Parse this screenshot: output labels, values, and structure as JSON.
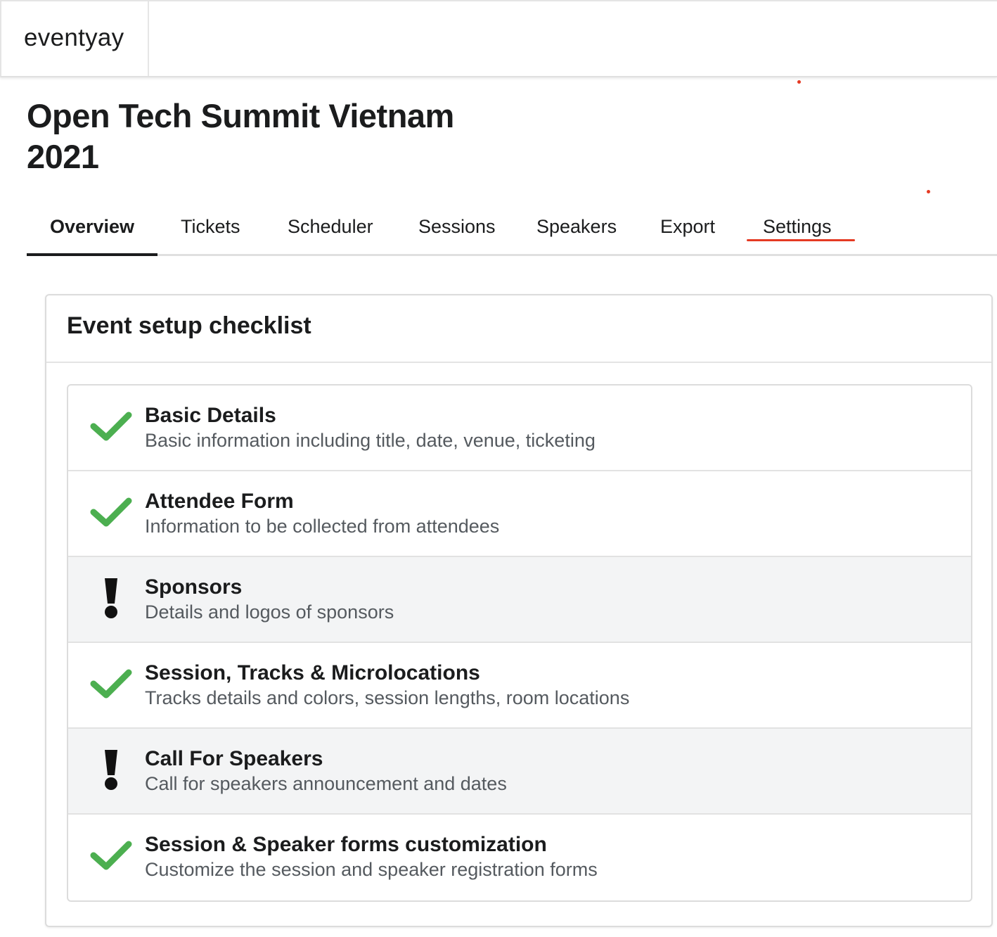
{
  "app": {
    "brand": "eventyay"
  },
  "event": {
    "title": "Open Tech Summit Vietnam 2021"
  },
  "tabs": [
    {
      "label": "Overview",
      "active": true
    },
    {
      "label": "Tickets",
      "active": false
    },
    {
      "label": "Scheduler",
      "active": false
    },
    {
      "label": "Sessions",
      "active": false
    },
    {
      "label": "Speakers",
      "active": false
    },
    {
      "label": "Export",
      "active": false
    },
    {
      "label": "Settings",
      "active": false
    }
  ],
  "checklist": {
    "title": "Event setup checklist",
    "items": [
      {
        "title": "Basic Details",
        "description": "Basic information including title, date, venue, ticketing",
        "status": "complete",
        "icon": "check-icon"
      },
      {
        "title": "Attendee Form",
        "description": "Information to be collected from attendees",
        "status": "complete",
        "icon": "check-icon"
      },
      {
        "title": "Sponsors",
        "description": "Details and logos of sponsors",
        "status": "incomplete",
        "icon": "exclamation-icon"
      },
      {
        "title": "Session, Tracks & Microlocations",
        "description": "Tracks details and colors, session lengths, room locations",
        "status": "complete",
        "icon": "check-icon"
      },
      {
        "title": "Call For Speakers",
        "description": "Call for speakers announcement and dates",
        "status": "incomplete",
        "icon": "exclamation-icon"
      },
      {
        "title": "Session & Speaker forms customization",
        "description": "Customize the session and speaker registration forms",
        "status": "complete",
        "icon": "check-icon"
      }
    ]
  },
  "colors": {
    "check": "#4caf50",
    "accent_underline": "#e53a23",
    "warning_row_bg": "#f3f4f5",
    "text": "#1b1c1d"
  }
}
